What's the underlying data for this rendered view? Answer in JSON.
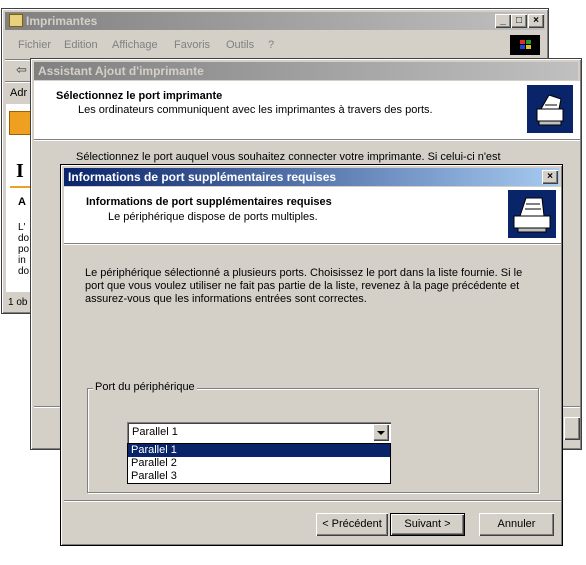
{
  "printers_window": {
    "title": "Imprimantes",
    "menu": [
      "Fichier",
      "Edition",
      "Affichage",
      "Favoris",
      "Outils",
      "?"
    ],
    "address_fragment": "Adr",
    "big_letter": "I",
    "side_heading": "A",
    "side_lines": [
      "L'",
      "do",
      "po",
      "in",
      "do"
    ],
    "status_fragment": "1 ob"
  },
  "wizard": {
    "title": "Assistant Ajout d'imprimante",
    "header_title": "Sélectionnez le port imprimante",
    "header_subtitle": "Les ordinateurs communiquent avec les imprimantes à travers des ports.",
    "instruction": "Sélectionnez le port auquel vous souhaitez connecter votre imprimante. Si celui-ci n'est"
  },
  "dialog": {
    "title": "Informations de port supplémentaires requises",
    "header_title": "Informations de port supplémentaires requises",
    "header_subtitle": "Le périphérique dispose de ports multiples.",
    "body_text": "Le périphérique sélectionné a plusieurs ports. Choisissez le port dans la liste fournie. Si le port que vous voulez utiliser ne fait pas partie de la liste, revenez à la page précédente et assurez-vous que les informations entrées sont correctes.",
    "group_label": "Port du périphérique",
    "select_value": "Parallel 1",
    "options": [
      "Parallel 1",
      "Parallel 2",
      "Parallel 3"
    ],
    "back_button": "< Précédent",
    "next_button": "Suivant >",
    "cancel_button": "Annuler"
  },
  "colors": {
    "active_title": "#0a246a",
    "selection": "#0a246a",
    "face": "#d4d0c8"
  }
}
